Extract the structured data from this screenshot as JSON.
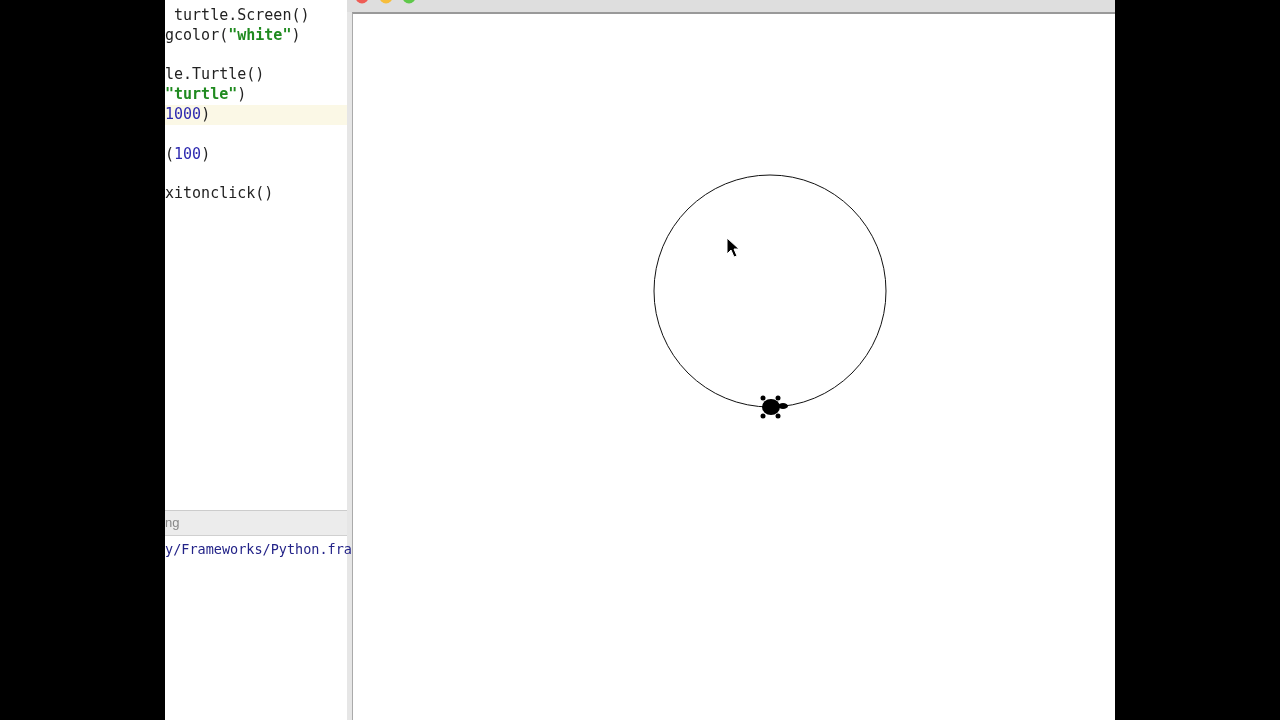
{
  "editor": {
    "lines": [
      {
        "kind": "code",
        "highlighted": false,
        "segments": [
          {
            "kind": "plain",
            "text": " turtle.Screen()"
          }
        ]
      },
      {
        "kind": "code",
        "highlighted": false,
        "segments": [
          {
            "kind": "plain",
            "text": "gcolor("
          },
          {
            "kind": "string",
            "text": "\"white\""
          },
          {
            "kind": "plain",
            "text": ")"
          }
        ]
      },
      {
        "kind": "blank"
      },
      {
        "kind": "code",
        "highlighted": false,
        "segments": [
          {
            "kind": "plain",
            "text": "le.Turtle()"
          }
        ]
      },
      {
        "kind": "code",
        "highlighted": false,
        "segments": [
          {
            "kind": "string",
            "text": "\"turtle\""
          },
          {
            "kind": "plain",
            "text": ")"
          }
        ]
      },
      {
        "kind": "code",
        "highlighted": true,
        "segments": [
          {
            "kind": "number",
            "text": "1000"
          },
          {
            "kind": "plain",
            "text": ")"
          }
        ]
      },
      {
        "kind": "blank"
      },
      {
        "kind": "code",
        "highlighted": false,
        "segments": [
          {
            "kind": "plain",
            "text": "("
          },
          {
            "kind": "number",
            "text": "100"
          },
          {
            "kind": "plain",
            "text": ")"
          }
        ]
      },
      {
        "kind": "blank"
      },
      {
        "kind": "code",
        "highlighted": false,
        "segments": [
          {
            "kind": "plain",
            "text": "xitonclick()"
          }
        ]
      }
    ]
  },
  "console": {
    "header": "ng",
    "output": "y/Frameworks/Python.fra"
  }
}
